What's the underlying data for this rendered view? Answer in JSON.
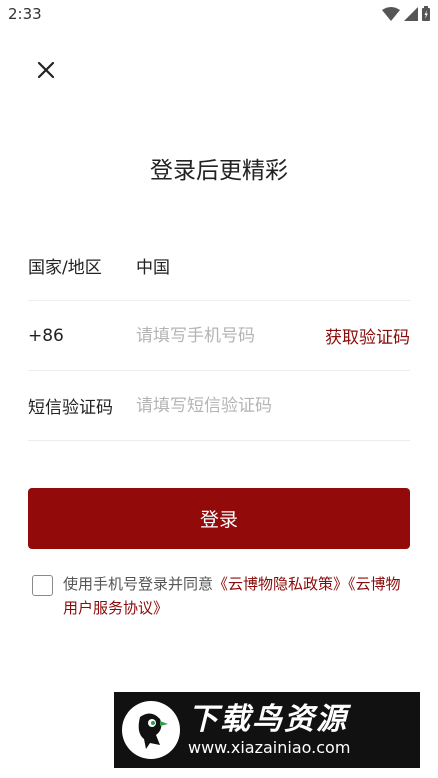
{
  "status_bar": {
    "time": "2:33",
    "icons": [
      "wifi-icon",
      "signal-icon",
      "battery-icon"
    ]
  },
  "close_icon": "close-icon",
  "title": "登录后更精彩",
  "region_row": {
    "label": "国家/地区",
    "value": "中国"
  },
  "phone_row": {
    "prefix": "+86",
    "placeholder": "请填写手机号码",
    "get_code": "获取验证码"
  },
  "code_row": {
    "label": "短信验证码",
    "placeholder": "请填写短信验证码"
  },
  "login_button": "登录",
  "agreement": {
    "text": "使用手机号登录并同意",
    "privacy_link": "《云博物隐私政策》",
    "service_link": "《云博物用户服务协议》"
  },
  "watermark": {
    "title": "下载鸟资源",
    "url": "www.xiazainiao.com"
  },
  "colors": {
    "accent": "#930a0a",
    "link": "#8b0a0a",
    "placeholder": "#b4b4b4",
    "divider": "#ededed"
  }
}
